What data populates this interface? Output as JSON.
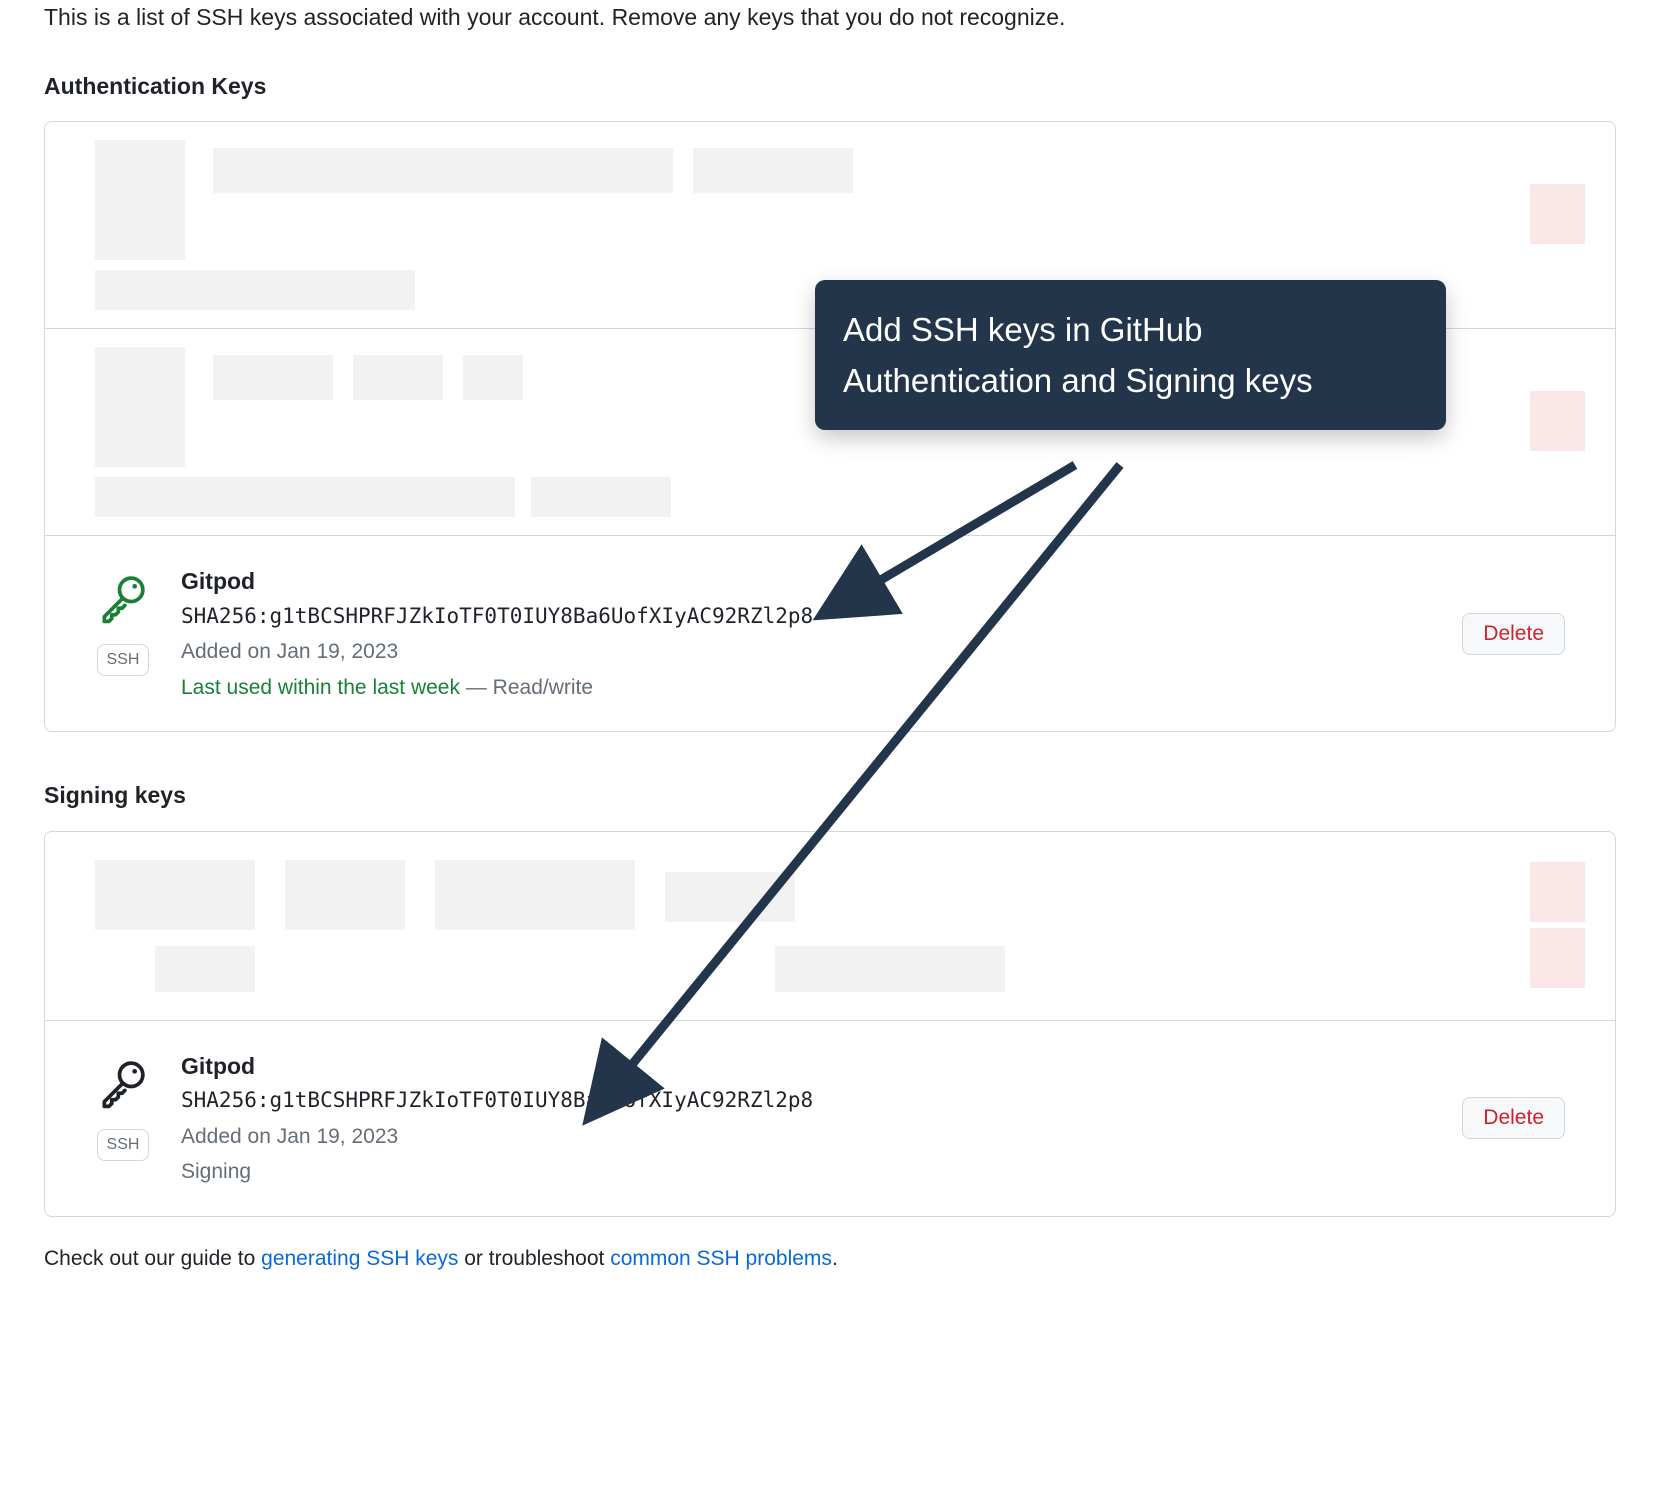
{
  "intro": "This is a list of SSH keys associated with your account. Remove any keys that you do not recognize.",
  "sections": {
    "auth": {
      "title": "Authentication Keys",
      "key": {
        "title": "Gitpod",
        "fingerprint": "SHA256:g1tBCSHPRFJZkIoTF0T0IUY8Ba6UofXIyAC92RZl2p8",
        "added": "Added on Jan 19, 2023",
        "last_used": "Last used within the last week",
        "access_sep": " — ",
        "access": "Read/write",
        "badge": "SSH",
        "delete_label": "Delete",
        "icon_color": "#1a7f37"
      }
    },
    "signing": {
      "title": "Signing keys",
      "key": {
        "title": "Gitpod",
        "fingerprint": "SHA256:g1tBCSHPRFJZkIoTF0T0IUY8Ba6UofXIyAC92RZl2p8",
        "added": "Added on Jan 19, 2023",
        "usage": "Signing",
        "badge": "SSH",
        "delete_label": "Delete",
        "icon_color": "#1f2328"
      }
    }
  },
  "footer": {
    "prefix": "Check out our guide to ",
    "link1": "generating SSH keys",
    "mid": " or troubleshoot ",
    "link2": "common SSH problems",
    "suffix": "."
  },
  "annotation": {
    "text": "Add SSH keys in GitHub Authentication and Signing keys"
  }
}
